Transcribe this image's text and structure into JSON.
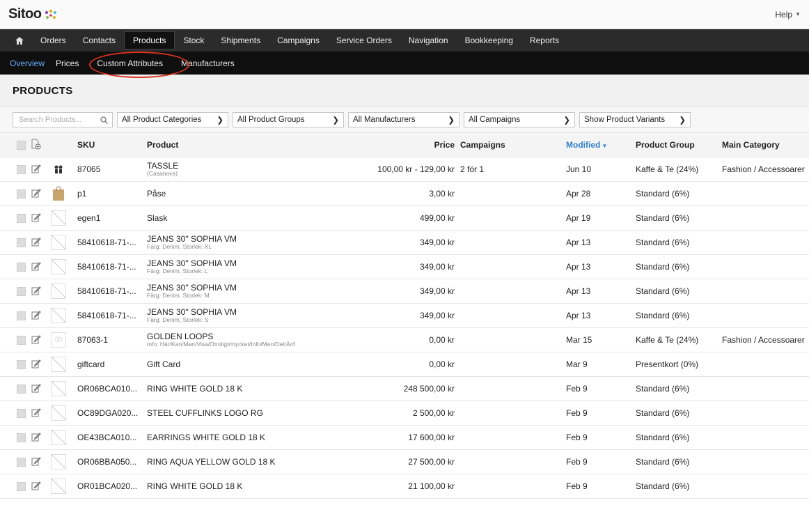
{
  "logo": {
    "text": "Sitoo"
  },
  "help": {
    "label": "Help"
  },
  "main_nav": [
    {
      "label": "Orders"
    },
    {
      "label": "Contacts"
    },
    {
      "label": "Products",
      "active": true
    },
    {
      "label": "Stock"
    },
    {
      "label": "Shipments"
    },
    {
      "label": "Campaigns"
    },
    {
      "label": "Service Orders"
    },
    {
      "label": "Navigation"
    },
    {
      "label": "Bookkeeping"
    },
    {
      "label": "Reports"
    }
  ],
  "sub_nav": [
    {
      "label": "Overview",
      "active": true
    },
    {
      "label": "Prices"
    },
    {
      "label": "Custom Attributes",
      "highlighted": true
    },
    {
      "label": "Manufacturers"
    }
  ],
  "page_title": "PRODUCTS",
  "filters": {
    "search_placeholder": "Search Products...",
    "categories": "All Product Categories",
    "groups": "All Product Groups",
    "manufacturers": "All Manufacturers",
    "campaigns": "All Campaigns",
    "variants": "Show Product Variants"
  },
  "table": {
    "headers": {
      "sku": "SKU",
      "product": "Product",
      "price": "Price",
      "campaigns": "Campaigns",
      "modified": "Modified",
      "group": "Product Group",
      "category": "Main Category"
    },
    "rows": [
      {
        "thumb": "people",
        "sku": "87065",
        "name": "TASSLE",
        "sub": "(Casanova)",
        "price": "100,00 kr - 129,00 kr",
        "campaigns": "2 för 1",
        "modified": "Jun 10",
        "group": "Kaffe & Te (24%)",
        "category": "Fashion / Accessoarer"
      },
      {
        "thumb": "bag",
        "sku": "p1",
        "name": "Påse",
        "sub": "",
        "price": "3,00 kr",
        "campaigns": "",
        "modified": "Apr 28",
        "group": "Standard (6%)",
        "category": ""
      },
      {
        "thumb": "empty",
        "sku": "egen1",
        "name": "Slask",
        "sub": "",
        "price": "499,00 kr",
        "campaigns": "",
        "modified": "Apr 19",
        "group": "Standard (6%)",
        "category": ""
      },
      {
        "thumb": "empty",
        "sku": "58410618-71-...",
        "name": "JEANS 30\" SOPHIA VM",
        "sub": "Färg: Denim, Storlek: XL",
        "price": "349,00 kr",
        "campaigns": "",
        "modified": "Apr 13",
        "group": "Standard (6%)",
        "category": ""
      },
      {
        "thumb": "empty",
        "sku": "58410618-71-...",
        "name": "JEANS 30\" SOPHIA VM",
        "sub": "Färg: Denim, Storlek: L",
        "price": "349,00 kr",
        "campaigns": "",
        "modified": "Apr 13",
        "group": "Standard (6%)",
        "category": ""
      },
      {
        "thumb": "empty",
        "sku": "58410618-71-...",
        "name": "JEANS 30\" SOPHIA VM",
        "sub": "Färg: Denim, Storlek: M",
        "price": "349,00 kr",
        "campaigns": "",
        "modified": "Apr 13",
        "group": "Standard (6%)",
        "category": ""
      },
      {
        "thumb": "empty",
        "sku": "58410618-71-...",
        "name": "JEANS 30\" SOPHIA VM",
        "sub": "Färg: Denim, Storlek: S",
        "price": "349,00 kr",
        "campaigns": "",
        "modified": "Apr 13",
        "group": "Standard (6%)",
        "category": ""
      },
      {
        "thumb": "faded",
        "sku": "87063-1",
        "name": "GOLDEN LOOPS",
        "sub": "Info: Här/Kan/Man/Visa/Otroligt/mycket/Info/Men/Det/Är/I",
        "price": "0,00 kr",
        "campaigns": "",
        "modified": "Mar 15",
        "group": "Kaffe & Te (24%)",
        "category": "Fashion / Accessoarer"
      },
      {
        "thumb": "empty",
        "sku": "giftcard",
        "name": "Gift Card",
        "sub": "",
        "price": "0,00 kr",
        "campaigns": "",
        "modified": "Mar 9",
        "group": "Presentkort (0%)",
        "category": ""
      },
      {
        "thumb": "empty",
        "sku": "OR06BCA010...",
        "name": "RING WHITE GOLD 18 K",
        "sub": "",
        "price": "248 500,00 kr",
        "campaigns": "",
        "modified": "Feb 9",
        "group": "Standard (6%)",
        "category": ""
      },
      {
        "thumb": "empty",
        "sku": "OC89DGA020...",
        "name": "STEEL CUFFLINKS LOGO RG",
        "sub": "",
        "price": "2 500,00 kr",
        "campaigns": "",
        "modified": "Feb 9",
        "group": "Standard (6%)",
        "category": ""
      },
      {
        "thumb": "empty",
        "sku": "OE43BCA010...",
        "name": "EARRINGS WHITE GOLD 18 K",
        "sub": "",
        "price": "17 600,00 kr",
        "campaigns": "",
        "modified": "Feb 9",
        "group": "Standard (6%)",
        "category": ""
      },
      {
        "thumb": "empty",
        "sku": "OR06BBA050...",
        "name": "RING AQUA YELLOW GOLD 18 K",
        "sub": "",
        "price": "27 500,00 kr",
        "campaigns": "",
        "modified": "Feb 9",
        "group": "Standard (6%)",
        "category": ""
      },
      {
        "thumb": "empty",
        "sku": "OR01BCA020...",
        "name": "RING WHITE GOLD 18 K",
        "sub": "",
        "price": "21 100,00 kr",
        "campaigns": "",
        "modified": "Feb 9",
        "group": "Standard (6%)",
        "category": ""
      }
    ]
  },
  "colors": {
    "nav_bg": "#2b2b2b",
    "subnav_bg": "#0f0f0f",
    "active_link": "#6ab0ff",
    "highlight": "#d9331f",
    "sort_link": "#2f7fd0"
  }
}
